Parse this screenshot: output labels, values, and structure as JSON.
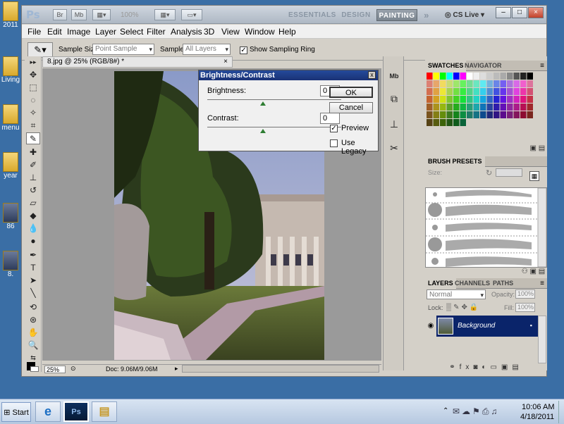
{
  "desktop": {
    "icons": [
      {
        "label": "2011",
        "kind": "folder"
      },
      {
        "label": "Living",
        "kind": "folder"
      },
      {
        "label": "menu",
        "kind": "folder"
      },
      {
        "label": "year",
        "kind": "folder"
      },
      {
        "label": "86",
        "kind": "image"
      },
      {
        "label": "8.",
        "kind": "image"
      }
    ]
  },
  "titlebar": {
    "app_logo": "Ps",
    "bridge_label": "Br",
    "minibridge_label": "Mb",
    "zoom_label": "100%",
    "workspaces": [
      "ESSENTIALS",
      "DESIGN",
      "PAINTING"
    ],
    "active_workspace": "PAINTING",
    "more_label": "»",
    "cslive_label": "CS Live",
    "window_controls": [
      "–",
      "□",
      "×"
    ]
  },
  "menubar": [
    "File",
    "Edit",
    "Image",
    "Layer",
    "Select",
    "Filter",
    "Analysis",
    "3D",
    "View",
    "Window",
    "Help"
  ],
  "options_bar": {
    "sample_size_label": "Sample Size:",
    "sample_size_value": "Point Sample",
    "sample_label": "Sample:",
    "sample_value": "All Layers",
    "sampling_ring_label": "Show Sampling Ring",
    "sampling_ring_checked": true
  },
  "document": {
    "tab_title": "8.jpg @ 25% (RGB/8#) *",
    "zoom": "25%",
    "doc_info": "Doc: 9.06M/9.06M"
  },
  "dialog": {
    "title": "Brightness/Contrast",
    "brightness_label": "Brightness:",
    "brightness_value": "0",
    "contrast_label": "Contrast:",
    "contrast_value": "0",
    "ok_label": "OK",
    "cancel_label": "Cancel",
    "preview_label": "Preview",
    "preview_checked": true,
    "legacy_label": "Use Legacy",
    "legacy_checked": false,
    "close_label": "x"
  },
  "swatches_panel": {
    "tabs": [
      "SWATCHES",
      "NAVIGATOR"
    ],
    "active_tab": "SWATCHES"
  },
  "brush_panel": {
    "tabs": [
      "BRUSH PRESETS"
    ],
    "size_label": "Size:"
  },
  "layers_panel": {
    "tabs": [
      "LAYERS",
      "CHANNELS",
      "PATHS"
    ],
    "active_tab": "LAYERS",
    "blend_mode": "Normal",
    "opacity_label": "Opacity:",
    "opacity_value": "100%",
    "lock_label": "Lock:",
    "fill_label": "Fill:",
    "fill_value": "100%",
    "layer_name": "Background"
  },
  "taskbar": {
    "start_label": "Start",
    "ps_label": "Ps",
    "time": "10:06 AM",
    "date": "4/18/2011"
  },
  "colors": {
    "desktop": "#3a6ea5",
    "layer_selected": "#0a246a",
    "dialog_title": "#244a9a"
  }
}
